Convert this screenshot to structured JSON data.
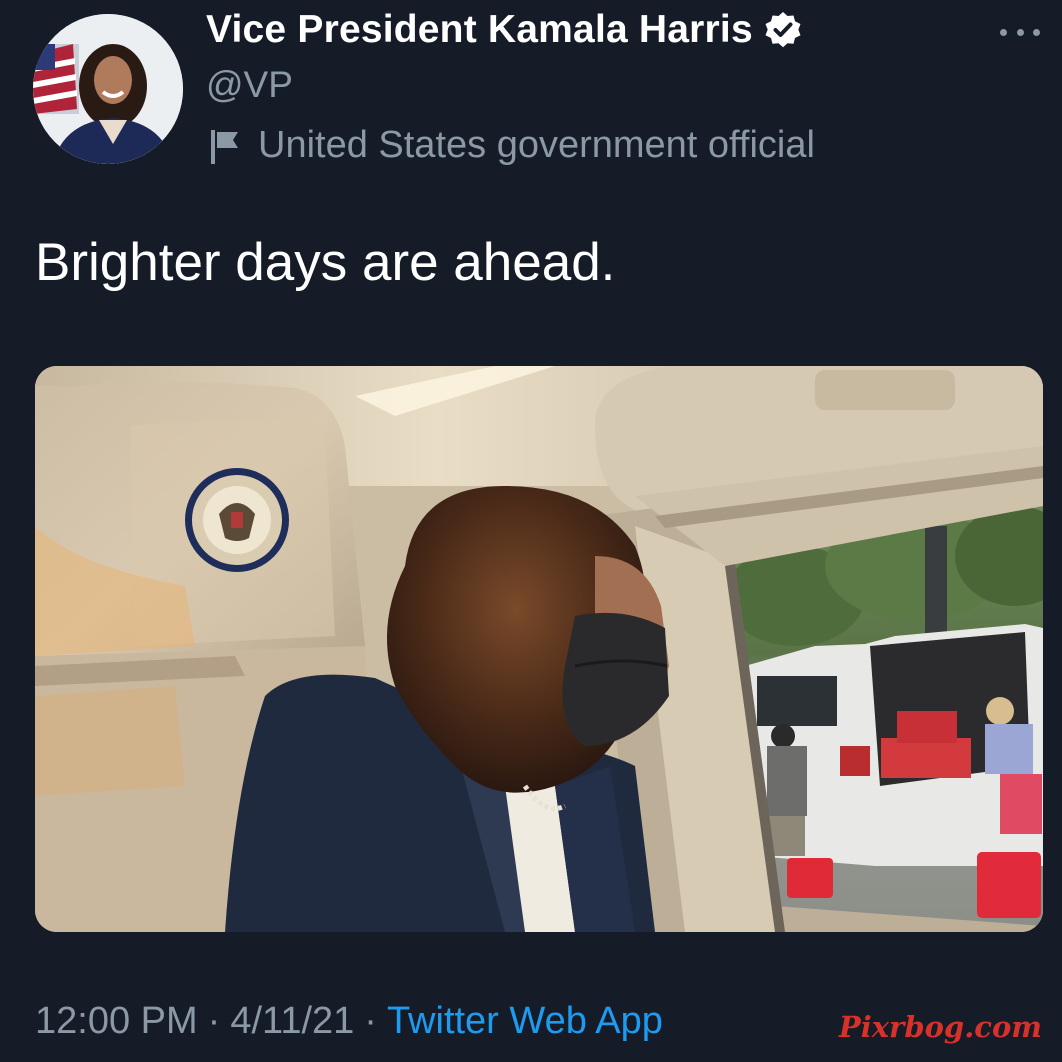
{
  "tweet": {
    "author": {
      "display_name": "Vice President Kamala Harris",
      "handle": "@VP",
      "verified": true,
      "label": "United States government official",
      "avatar_icon": "profile-photo"
    },
    "text": "Brighter days are ahead.",
    "media": {
      "type": "photo",
      "icon": "photo-image"
    },
    "meta": {
      "time": "12:00 PM",
      "separator": "·",
      "date": "4/11/21",
      "source": "Twitter Web App"
    }
  },
  "watermark": "Pixrbog.com",
  "colors": {
    "background": "#151c27",
    "primary_text": "#ffffff",
    "secondary_text": "#8b98a5",
    "link": "#1d9bf0",
    "watermark": "#d7312a"
  }
}
